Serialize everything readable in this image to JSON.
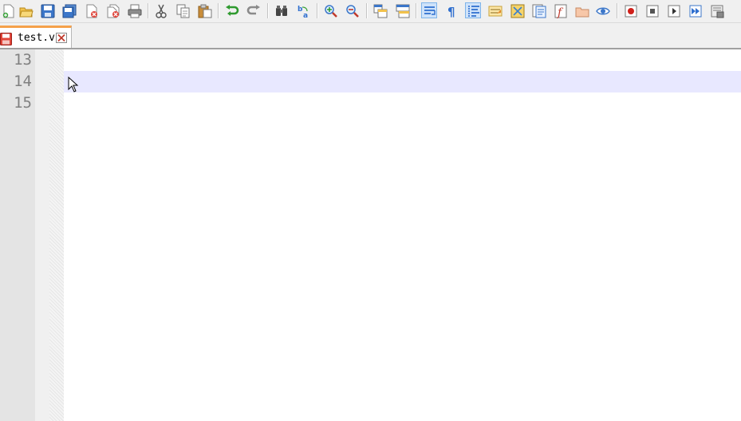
{
  "tab": {
    "label": "test.v",
    "save_icon": "save-icon",
    "close_icon": "close-icon"
  },
  "editor": {
    "lines": [
      {
        "number": "13",
        "text": ""
      },
      {
        "number": "14",
        "text": ""
      },
      {
        "number": "15",
        "text": ""
      }
    ],
    "current_line_color": "#e8e8ff"
  },
  "toolbar": {
    "icons": [
      "new-file-icon",
      "open-file-icon",
      "save-icon",
      "save-all-icon",
      "close-icon",
      "close-all-icon",
      "print-icon",
      "cut-icon",
      "copy-icon",
      "paste-icon",
      "undo-icon",
      "redo-icon",
      "find-icon",
      "replace-icon",
      "zoom-in-icon",
      "zoom-out-icon",
      "sync-vertical-icon",
      "sync-horizontal-icon",
      "word-wrap-icon",
      "show-all-chars-icon",
      "indent-guide-icon",
      "user-language-icon",
      "document-map-icon",
      "function-list-icon",
      "folder-as-workspace-icon",
      "folder-icon",
      "monitoring-icon",
      "record-macro-icon",
      "stop-macro-icon",
      "play-macro-icon",
      "run-macro-multiple-icon",
      "save-macro-icon"
    ],
    "accent": "#f5a14b"
  }
}
